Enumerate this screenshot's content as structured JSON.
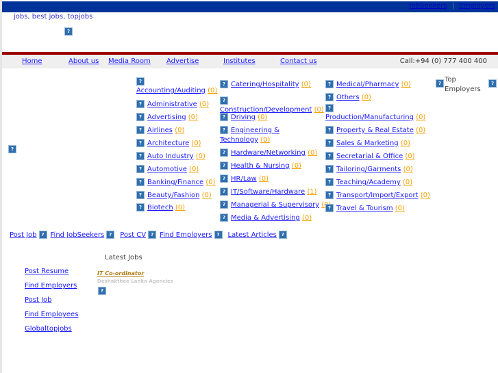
{
  "topbar": {
    "links": [
      "JobSeekers",
      "Employers"
    ],
    "separator": "|"
  },
  "tagline": "jobs, best jobs, topjobs",
  "nav": {
    "items": [
      "Home",
      "About us",
      "Media Room",
      "Advertise",
      "Institutes",
      "Contact us"
    ],
    "phone": "Call:+94 (0) 777 400 400"
  },
  "categories": [
    {
      "name": "Accounting/Auditing",
      "count": "(0)"
    },
    {
      "name": "Administrative",
      "count": "(0)"
    },
    {
      "name": "Advertising",
      "count": "(0)"
    },
    {
      "name": "Airlines",
      "count": "(0)"
    },
    {
      "name": "Architecture",
      "count": "(0)"
    },
    {
      "name": "Auto Industry",
      "count": "(0)"
    },
    {
      "name": "Automotive",
      "count": "(0)"
    },
    {
      "name": "Banking/Finance",
      "count": "(0)"
    },
    {
      "name": "Beauty/Fashion",
      "count": "(0)"
    },
    {
      "name": "Biotech",
      "count": "(0)"
    },
    {
      "name": "Catering/Hospitality",
      "count": "(0)"
    },
    {
      "name": "Construction/Development",
      "count": "(0)"
    },
    {
      "name": "Driving",
      "count": "(0)"
    },
    {
      "name": "Engineering & Technology",
      "count": "(0)"
    },
    {
      "name": "Hardware/Networking",
      "count": "(0)"
    },
    {
      "name": "Health & Nursing",
      "count": "(0)"
    },
    {
      "name": "HR/Law",
      "count": "(0)"
    },
    {
      "name": "IT/Software/Hardware",
      "count": "(1)"
    },
    {
      "name": "Managerial & Supervisory",
      "count": "(0)"
    },
    {
      "name": "Media & Advertising",
      "count": "(0)"
    },
    {
      "name": "Medical/Pharmacy",
      "count": "(0)"
    },
    {
      "name": "Others",
      "count": "(0)"
    },
    {
      "name": "Production/Manufacturing",
      "count": "(0)"
    },
    {
      "name": "Property & Real Estate",
      "count": "(0)"
    },
    {
      "name": "Sales & Marketing",
      "count": "(0)"
    },
    {
      "name": "Secretarial & Office",
      "count": "(0)"
    },
    {
      "name": "Tailoring/Garments",
      "count": "(0)"
    },
    {
      "name": "Teaching/Academy",
      "count": "(0)"
    },
    {
      "name": "Transport/Import/Export",
      "count": "(0)"
    },
    {
      "name": "Travel & Tourism",
      "count": "(0)"
    }
  ],
  "top_employers": "Top Employers",
  "bottom_links": [
    "Post Job",
    "Find JobSeekers",
    "Post CV",
    "Find Employers",
    "Latest Articles"
  ],
  "side_links": [
    "Post Resume",
    "Find Employers",
    "Post Job",
    "Find Employees",
    "Globaltopjobs"
  ],
  "latest_jobs": {
    "title": "Latest Jobs",
    "job_title": "IT Co-ordinator",
    "company": "Deshakthee Lanka Agencies"
  },
  "icons": {
    "broken_image": "broken-image-icon"
  },
  "colors": {
    "topbar": "#003399",
    "accent_line": "#990000",
    "link": "#1a1aff",
    "count": "#f5a000"
  }
}
